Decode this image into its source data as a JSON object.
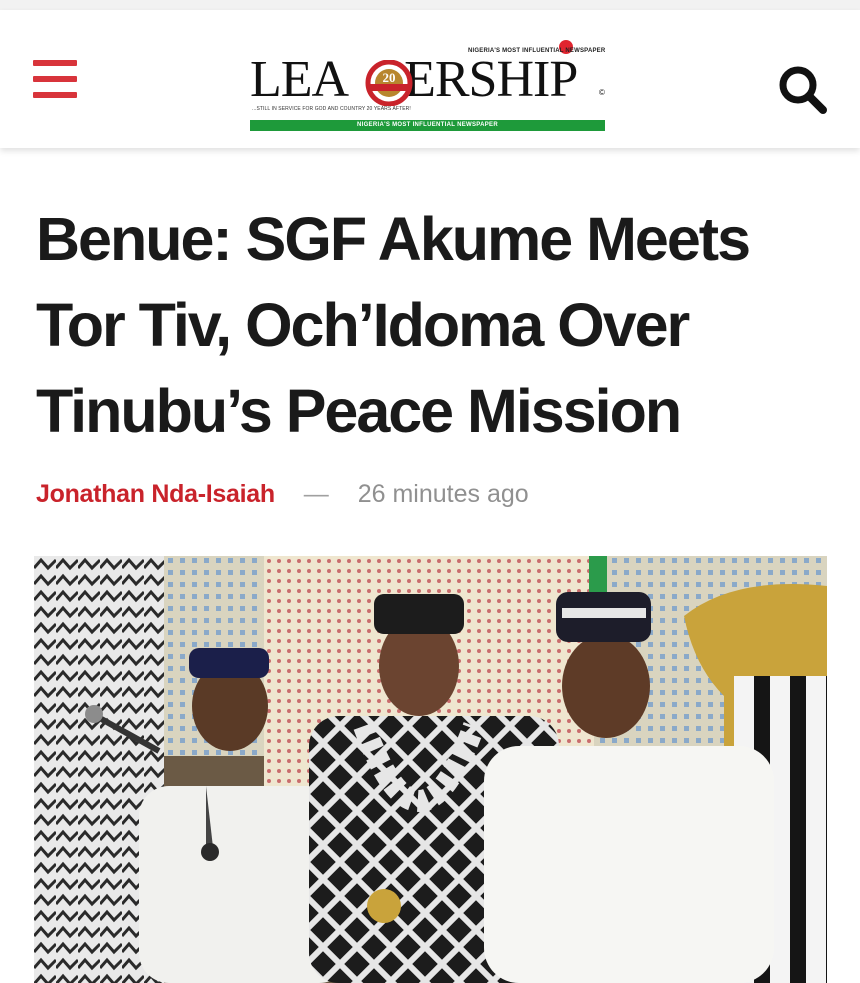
{
  "header": {
    "menu_icon": "hamburger-menu-icon",
    "search_icon": "search-icon",
    "logo": {
      "wordmark": "LEADERSHIP",
      "top_line": "NIGERIA'S MOST INFLUENTIAL NEWSPAPER",
      "tagline": "...STILL IN SERVICE FOR GOD AND COUNTRY 20 YEARS AFTER!",
      "bar_text": "NIGERIA'S MOST INFLUENTIAL NEWSPAPER",
      "reg_mark": "©",
      "emblem_text": "20"
    }
  },
  "article": {
    "title": "Benue: SGF Akume Meets Tor Tiv, Och’Idoma Over Tinubu’s Peace Mission",
    "author": "Jonathan Nda-Isaiah",
    "separator": "—",
    "time": "26 minutes ago"
  },
  "colors": {
    "brand_red": "#d8343b",
    "author_red": "#c9232b",
    "headline": "#1a1a1a",
    "meta_gray": "#909090",
    "logo_green": "#1e9a3a"
  }
}
